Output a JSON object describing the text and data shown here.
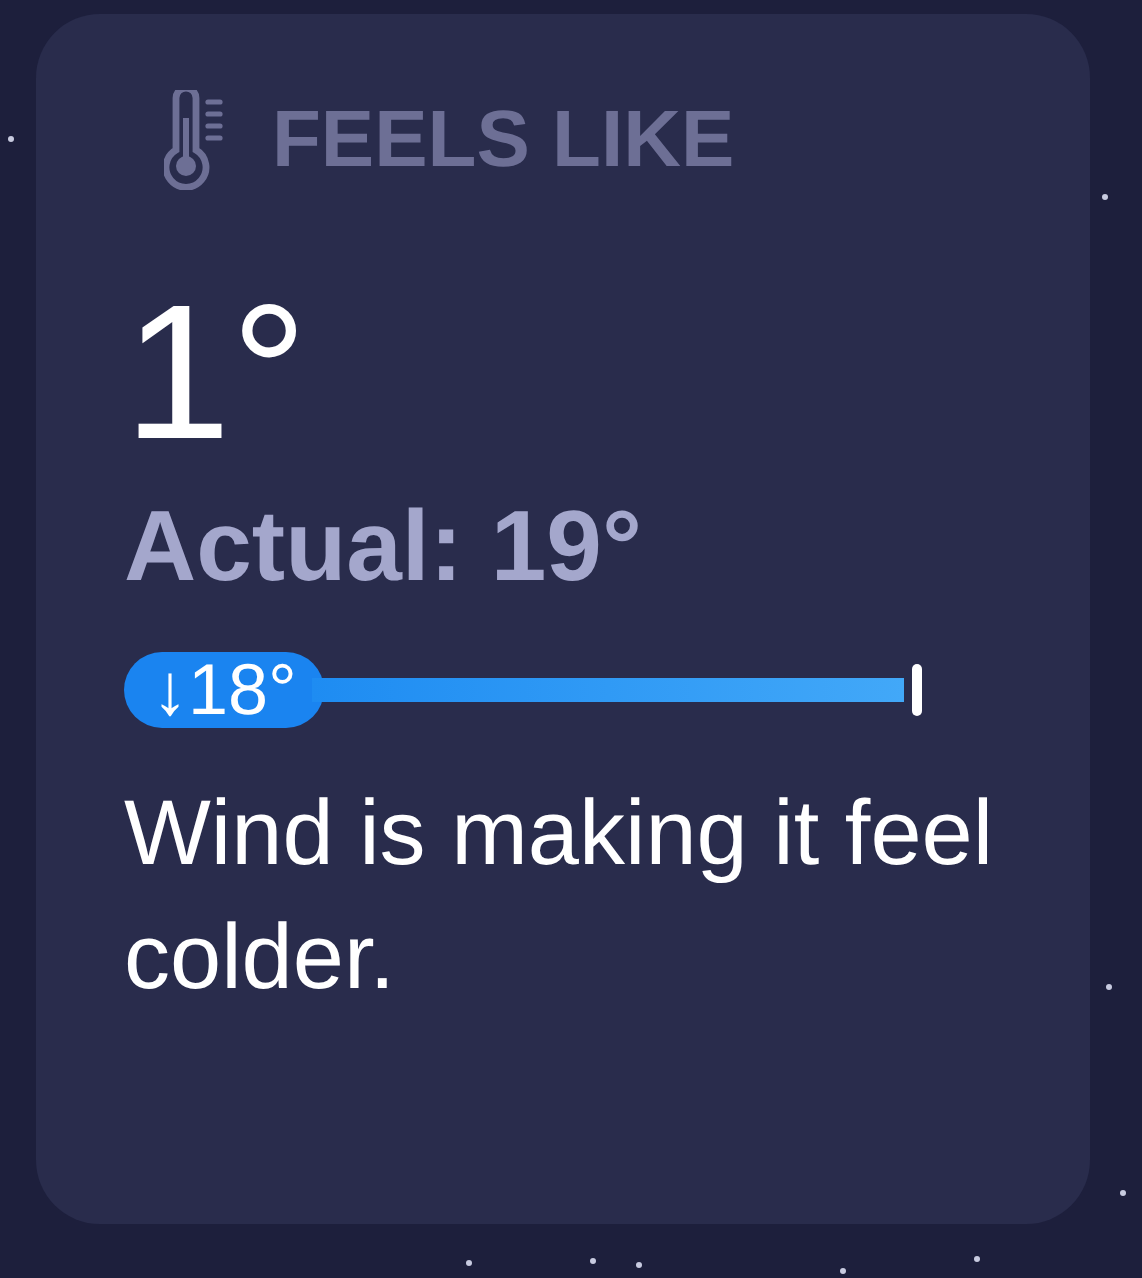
{
  "widget": {
    "title": "FEELS LIKE",
    "value": "1°",
    "actual": "Actual: 19°",
    "difference": "↓18°",
    "description": "Wind is making it feel colder."
  }
}
